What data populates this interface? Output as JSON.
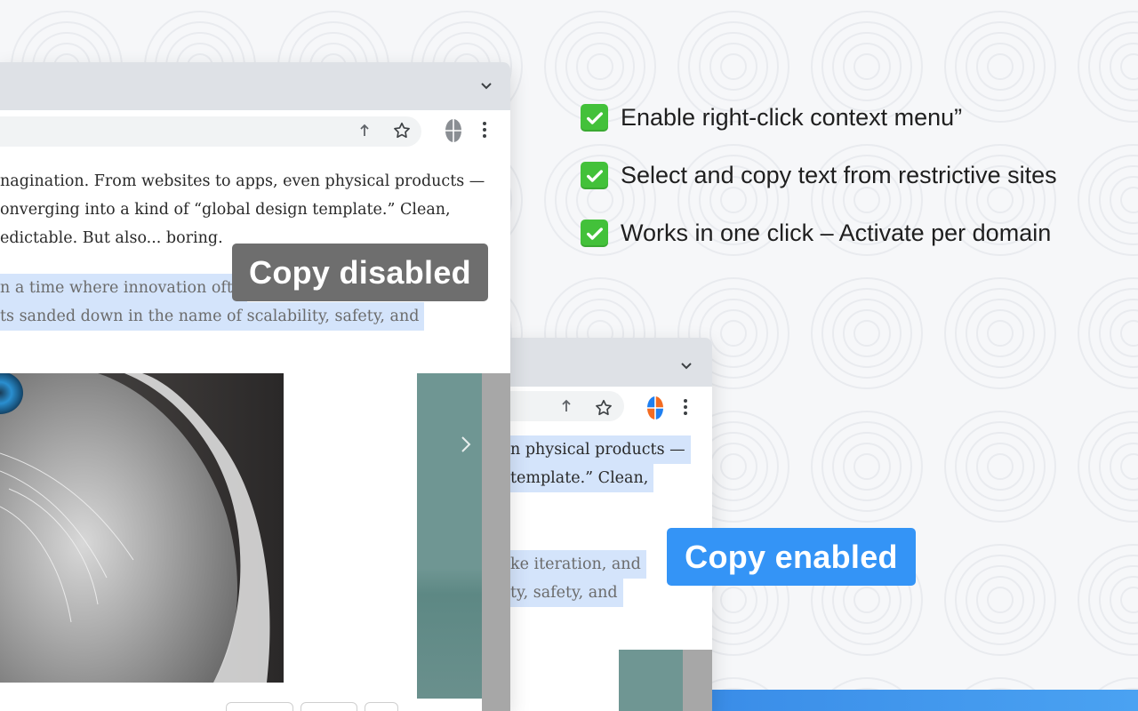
{
  "features": [
    {
      "icon": "check-icon",
      "text": "Enable right-click context menu”"
    },
    {
      "icon": "check-icon",
      "text": "Select and copy text from restrictive sites"
    },
    {
      "icon": "check-icon",
      "text": "Works in one click – Activate per domain"
    }
  ],
  "window_disabled": {
    "paragraph1": [
      "nagination. From websites to apps, even physical products —",
      "onverging into a kind of “global design template.” Clean,",
      "edictable. But also... boring."
    ],
    "paragraph2": [
      "n a time where innovation ofte",
      "ts sanded down in the name of scalability, safety, and"
    ],
    "badge": "Copy disabled",
    "extension_state": "inactive"
  },
  "window_enabled": {
    "paragraph1": [
      "n physical products —",
      " template.” Clean,"
    ],
    "paragraph2": [
      "ke iteration, and",
      "ty, safety, and"
    ],
    "badge": "Copy enabled",
    "extension_state": "active"
  },
  "colors": {
    "badge_disabled": "#6e6e6e",
    "badge_enabled": "#3494f6",
    "check": "#43c13a",
    "highlight": "#d4e4fb"
  }
}
